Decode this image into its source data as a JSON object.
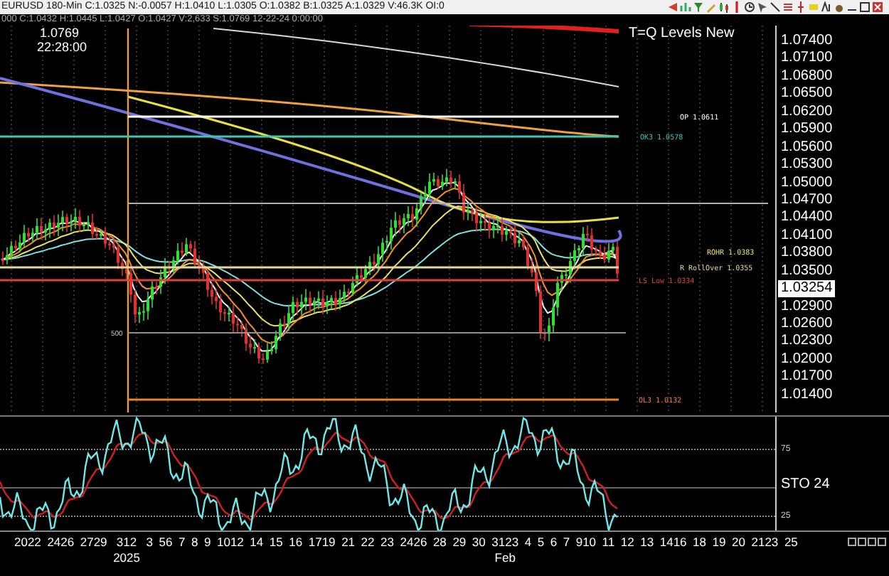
{
  "header": {
    "quote": "EURUSD 180-Min C:1.0325 N:-0.0057 H:1.0410 L:1.0305 O:1.0382 B:1.0325 A:1.0329 V:46.3K OI:0",
    "bar_info": "000 C:1.0432 H:1.0445 L:1.0427 O:1.0427 V:2,633 S:1.0769 12-22-24 0:00:00"
  },
  "price_chart": {
    "cursor": {
      "price": "1.0769",
      "time": "22:28:00"
    },
    "title": "T=Q Levels New",
    "marker": "500",
    "levels": [
      {
        "label": "OP 1.0611",
        "color": "#ffffff"
      },
      {
        "label": "OK3 1.0578",
        "color": "#3cc8b4"
      },
      {
        "label": "ROHR 1.0383",
        "color": "#e8e070"
      },
      {
        "label": "R RollOver 1.0355",
        "color": "#e0d8a0"
      },
      {
        "label": "LS Low 1.0334",
        "color": "#e04040"
      },
      {
        "label": "OL3 1.0132",
        "color": "#f08030"
      }
    ],
    "axis": {
      "ticks": [
        "1.07400",
        "1.07100",
        "1.06800",
        "1.06500",
        "1.06200",
        "1.05900",
        "1.05600",
        "1.05300",
        "1.05000",
        "1.04700",
        "1.04400",
        "1.04100",
        "1.03800",
        "1.03500",
        "1.02900",
        "1.02600",
        "1.02300",
        "1.02000",
        "1.01700",
        "1.01400"
      ],
      "current_price": "1.03254"
    }
  },
  "stochastic": {
    "label": "STO 24",
    "ticks": [
      "75",
      "25"
    ]
  },
  "time_axis": [
    {
      "label": "2022"
    },
    {
      "label": "2426"
    },
    {
      "label": "2729"
    },
    {
      "label": "312",
      "sub": "2025"
    },
    {
      "label": "3"
    },
    {
      "label": "56"
    },
    {
      "label": "7"
    },
    {
      "label": "8"
    },
    {
      "label": "9"
    },
    {
      "label": "1012"
    },
    {
      "label": "14"
    },
    {
      "label": "15"
    },
    {
      "label": "16"
    },
    {
      "label": "1719"
    },
    {
      "label": "21"
    },
    {
      "label": "22"
    },
    {
      "label": "23"
    },
    {
      "label": "2426"
    },
    {
      "label": "28"
    },
    {
      "label": "29"
    },
    {
      "label": "30"
    },
    {
      "label": "3123",
      "sub": "Feb"
    },
    {
      "label": "4"
    },
    {
      "label": "5"
    },
    {
      "label": "6"
    },
    {
      "label": "7"
    },
    {
      "label": "910"
    },
    {
      "label": "11"
    },
    {
      "label": "12"
    },
    {
      "label": "13"
    },
    {
      "label": "1416"
    },
    {
      "label": "18"
    },
    {
      "label": "19"
    },
    {
      "label": "20"
    },
    {
      "label": "2123"
    },
    {
      "label": "25"
    }
  ]
}
